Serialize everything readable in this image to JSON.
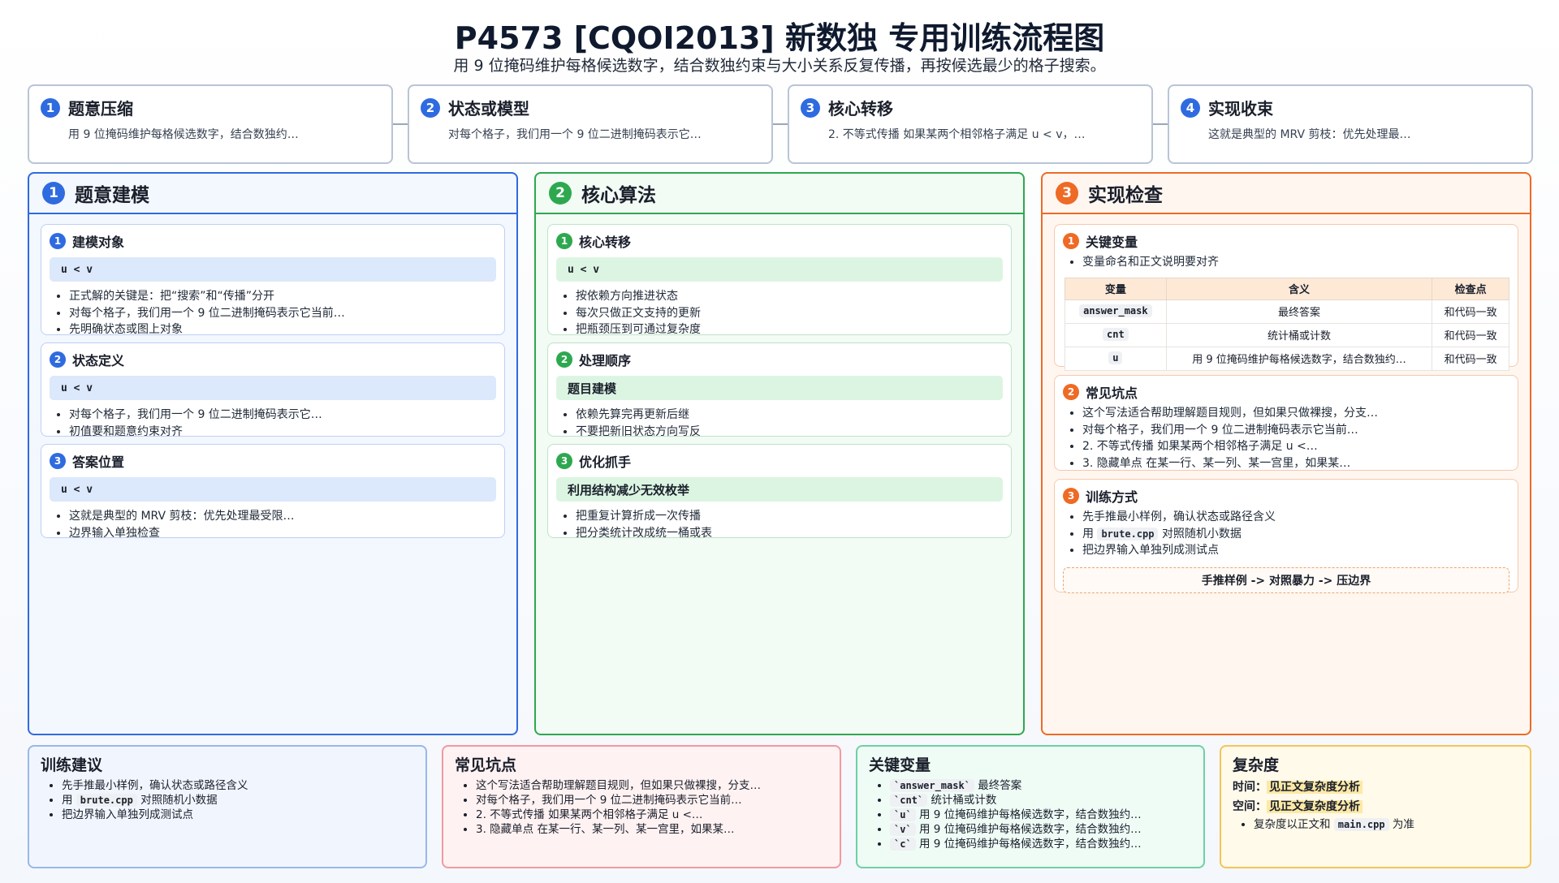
{
  "header": {
    "title": "P4573 [CQOI2013] 新数独 专用训练流程图",
    "subtitle": "用 9 位掩码维护每格候选数字，结合数独约束与大小关系反复传播，再按候选最少的格子搜索。"
  },
  "colors": {
    "blue": "#2f6be0",
    "green": "#2ea84f",
    "orange": "#ee6a25"
  },
  "steps": [
    {
      "num": "1",
      "title": "题意压缩",
      "desc": "用 9 位掩码维护每格候选数字，结合数独约…"
    },
    {
      "num": "2",
      "title": "状态或模型",
      "desc": "对每个格子，我们用一个 9 位二进制掩码表示它…"
    },
    {
      "num": "3",
      "title": "核心转移",
      "desc": "2. 不等式传播 如果某两个相邻格子满足 u < v，…"
    },
    {
      "num": "4",
      "title": "实现收束",
      "desc": "这就是典型的 MRV 剪枝：优先处理最…"
    }
  ],
  "panel1": {
    "num": "1",
    "title": "题意建模",
    "cards": [
      {
        "num": "1",
        "title": "建模对象",
        "code": "u < v",
        "bullets": [
          "正式解的关键是：把“搜索”和“传播”分开",
          "对每个格子，我们用一个 9 位二进制掩码表示它当前…",
          "先明确状态或图上对象"
        ]
      },
      {
        "num": "2",
        "title": "状态定义",
        "code": "u < v",
        "bullets": [
          "对每个格子，我们用一个 9 位二进制掩码表示它…",
          "初值要和题意约束对齐"
        ]
      },
      {
        "num": "3",
        "title": "答案位置",
        "code": "u < v",
        "bullets": [
          "这就是典型的 MRV 剪枝：优先处理最受限…",
          "边界输入单独检查"
        ]
      }
    ]
  },
  "panel2": {
    "num": "2",
    "title": "核心算法",
    "cards": [
      {
        "num": "1",
        "title": "核心转移",
        "code": "u < v",
        "bullets": [
          "按依赖方向推进状态",
          "每次只做正文支持的更新",
          "把瓶颈压到可通过复杂度"
        ]
      },
      {
        "num": "2",
        "title": "处理顺序",
        "code": "题目建模",
        "bullets": [
          "依赖先算完再更新后继",
          "不要把新旧状态方向写反"
        ]
      },
      {
        "num": "3",
        "title": "优化抓手",
        "code": "利用结构减少无效枚举",
        "bullets": [
          "把重复计算折成一次传播",
          "把分类统计改成统一桶或表"
        ]
      }
    ]
  },
  "panel3": {
    "num": "3",
    "title": "实现检查",
    "vars_card": {
      "num": "1",
      "title": "关键变量",
      "bullet": "变量命名和正文说明要对齐",
      "headers": [
        "变量",
        "含义",
        "检查点"
      ],
      "rows": [
        [
          "answer_mask",
          "最终答案",
          "和代码一致"
        ],
        [
          "cnt",
          "统计桶或计数",
          "和代码一致"
        ],
        [
          "u",
          "用 9 位掩码维护每格候选数字，结合数独约…",
          "和代码一致"
        ]
      ]
    },
    "pitfalls_card": {
      "num": "2",
      "title": "常见坑点",
      "bullets": [
        "这个写法适合帮助理解题目规则，但如果只做裸搜，分支…",
        "对每个格子，我们用一个 9 位二进制掩码表示它当前…",
        "2. 不等式传播 如果某两个相邻格子满足 u <…",
        "3. 隐藏单点 在某一行、某一列、某一宫里，如果某…"
      ]
    },
    "train_card": {
      "num": "3",
      "title": "训练方式",
      "b1": "先手推最小样例，确认状态或路径含义",
      "b2_pre": "用",
      "b2_code": "brute.cpp",
      "b2_post": "对照随机小数据",
      "b3": "把边界输入单独列成测试点",
      "flow": "手推样例 -> 对照暴力 -> 压边界"
    }
  },
  "bottom": {
    "training": {
      "title": "训练建议",
      "b1": "先手推最小样例，确认状态或路径含义",
      "b2_pre": "用",
      "b2_code": "brute.cpp",
      "b2_post": "对照随机小数据",
      "b3": "把边界输入单独列成测试点"
    },
    "pitfalls": {
      "title": "常见坑点",
      "bullets": [
        "这个写法适合帮助理解题目规则，但如果只做裸搜，分支…",
        "对每个格子，我们用一个 9 位二进制掩码表示它当前…",
        "2. 不等式传播 如果某两个相邻格子满足 u <…",
        "3. 隐藏单点 在某一行、某一列、某一宫里，如果某…"
      ]
    },
    "vars": {
      "title": "关键变量",
      "items": [
        {
          "code": "`answer_mask`",
          "text": "最终答案"
        },
        {
          "code": "`cnt`",
          "text": "统计桶或计数"
        },
        {
          "code": "`u`",
          "text": "用 9 位掩码维护每格候选数字，结合数独约…"
        },
        {
          "code": "`v`",
          "text": "用 9 位掩码维护每格候选数字，结合数独约…"
        },
        {
          "code": "`c`",
          "text": "用 9 位掩码维护每格候选数字，结合数独约…"
        }
      ]
    },
    "complexity": {
      "title": "复杂度",
      "time_label": "时间：",
      "time_value": "见正文复杂度分析",
      "space_label": "空间：",
      "space_value": "见正文复杂度分析",
      "note_pre": "复杂度以正文和",
      "note_code": "main.cpp",
      "note_post": "为准"
    }
  }
}
